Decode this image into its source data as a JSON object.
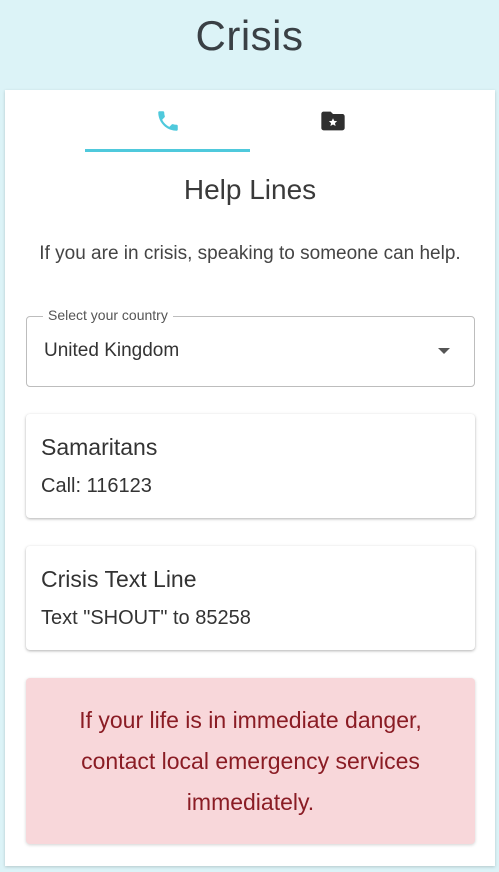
{
  "header": {
    "title": "Crisis"
  },
  "tabs": [
    {
      "icon": "phone-icon",
      "active": true
    },
    {
      "icon": "folder-star-icon",
      "active": false
    }
  ],
  "accent_color": "#4fc9dc",
  "section": {
    "title": "Help Lines",
    "intro": "If you are in crisis, speaking to someone can help."
  },
  "country_select": {
    "label": "Select your country",
    "value": "United Kingdom"
  },
  "help_lines": [
    {
      "name": "Samaritans",
      "detail": "Call: 116123"
    },
    {
      "name": "Crisis Text Line",
      "detail": "Text \"SHOUT\" to 85258"
    }
  ],
  "alert": {
    "text": "If your life is in immediate danger, contact local emergency services immediately.",
    "background": "#f8d7da",
    "color": "#8a1c24"
  }
}
